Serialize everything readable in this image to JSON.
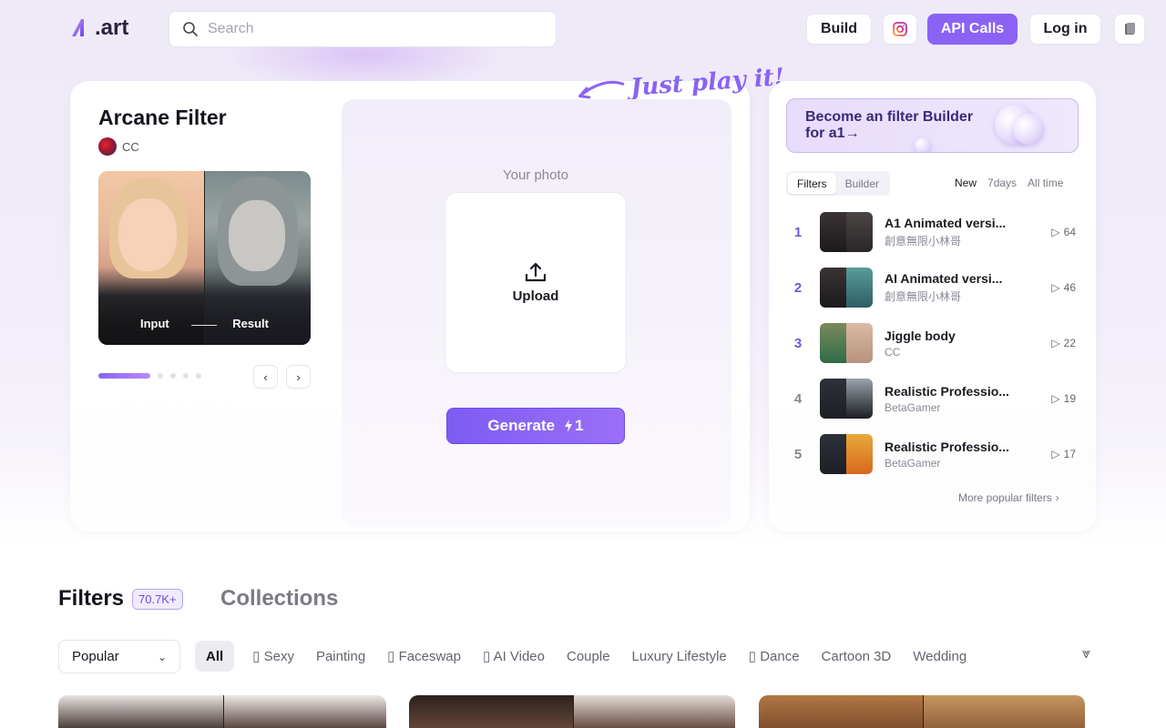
{
  "header": {
    "logo_text": ".art",
    "search_placeholder": "Search",
    "build_label": "Build",
    "api_label": "API Calls",
    "login_label": "Log in"
  },
  "hero": {
    "tagline": "Just play it!",
    "filter_title": "Arcane Filter",
    "author": "CC",
    "input_label": "Input",
    "result_label": "Result",
    "your_photo_label": "Your photo",
    "upload_label": "Upload",
    "generate_label": "Generate",
    "generate_cost": "1",
    "carousel_active_index": 0,
    "carousel_count": 5
  },
  "side": {
    "banner_line1": "Become an filter Builder",
    "banner_line2": "for a1→",
    "tabs": [
      "Filters",
      "Builder"
    ],
    "periods": [
      "New",
      "7days",
      "All time"
    ],
    "ranking": [
      {
        "rank": "1",
        "title": "A1 Animated versi...",
        "author": "創意無限小林哥",
        "plays": "64"
      },
      {
        "rank": "2",
        "title": "AI Animated versi...",
        "author": "創意無限小林哥",
        "plays": "46"
      },
      {
        "rank": "3",
        "title": "Jiggle body",
        "author": "CC",
        "plays": "22"
      },
      {
        "rank": "4",
        "title": "Realistic Professio...",
        "author": "BetaGamer",
        "plays": "19"
      },
      {
        "rank": "5",
        "title": "Realistic Professio...",
        "author": "BetaGamer",
        "plays": "17"
      }
    ],
    "more_label": "More popular filters"
  },
  "section": {
    "filters_tab": "Filters",
    "filters_count": "70.7K+",
    "collections_tab": "Collections",
    "sort_value": "Popular",
    "categories": [
      "All",
      "▯ Sexy",
      "Painting",
      "▯ Faceswap",
      "▯ AI Video",
      "Couple",
      "Luxury Lifestyle",
      "▯ Dance",
      "Cartoon 3D",
      "Wedding"
    ]
  },
  "colors": {
    "accent": "#8a63f5",
    "rank_color": "#6a5ae0"
  }
}
